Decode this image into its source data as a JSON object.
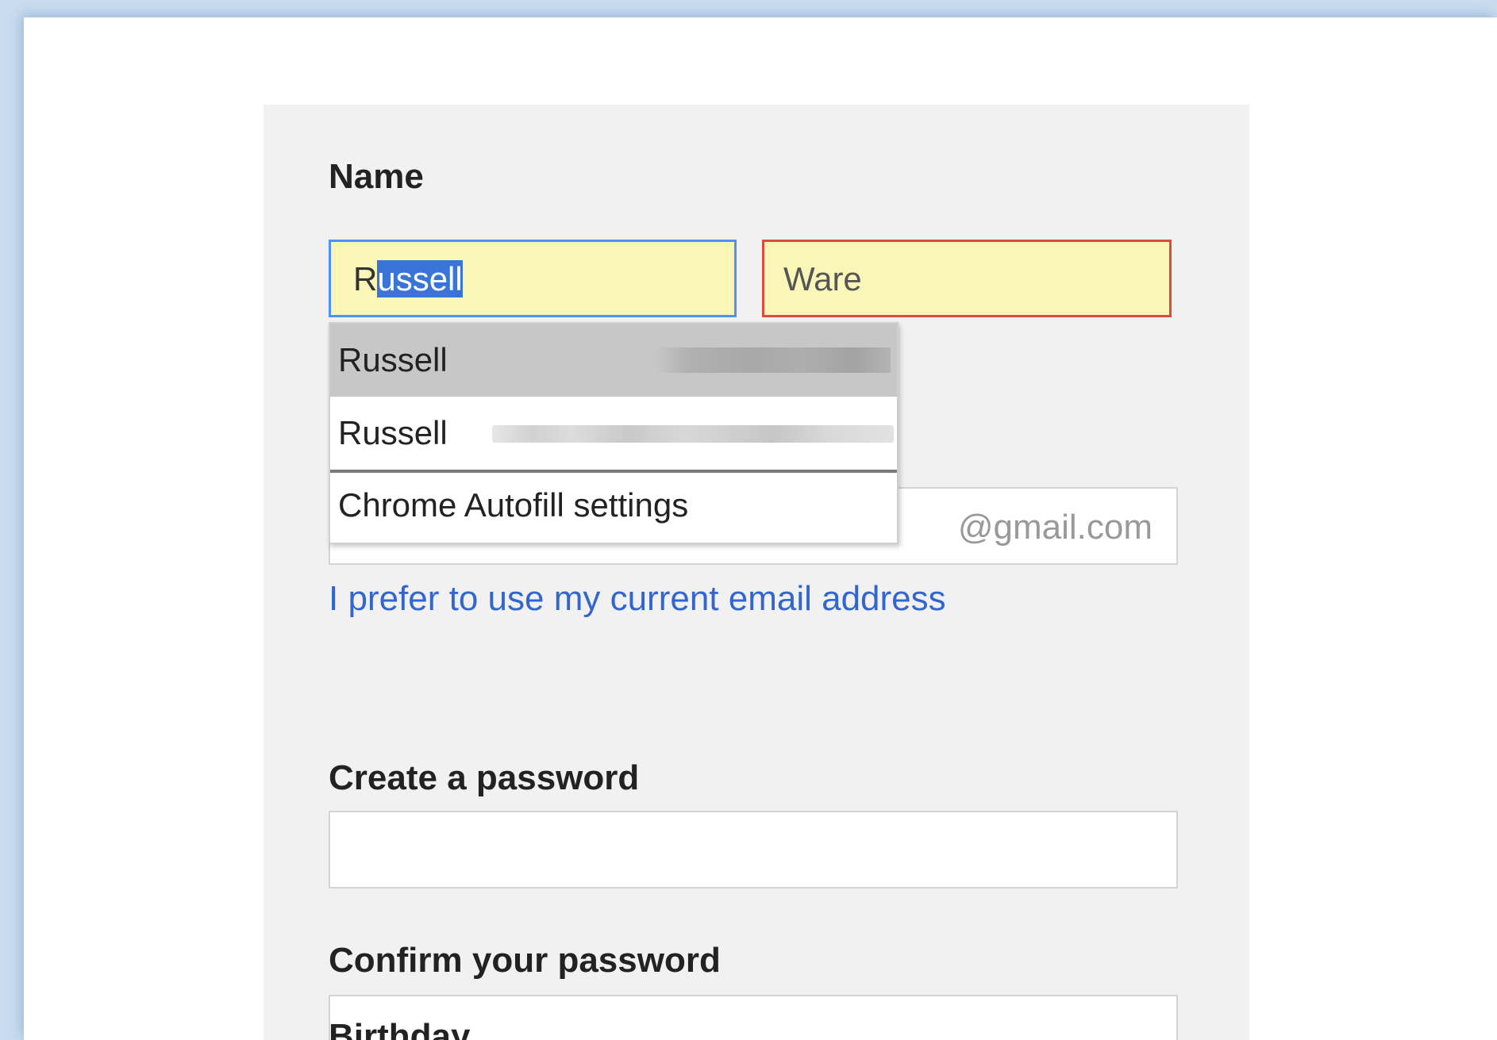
{
  "form": {
    "name_label": "Name",
    "first_name": {
      "value_unselected": "R",
      "value_selected": "ussell"
    },
    "last_name": {
      "value": "Ware"
    },
    "email": {
      "suffix": "@gmail.com"
    },
    "current_email_link": "I prefer to use my current email address",
    "password_label": "Create a password",
    "confirm_password_label": "Confirm your password",
    "birthday_label": "Birthday"
  },
  "autofill": {
    "suggestions": [
      {
        "name": "Russell"
      },
      {
        "name": "Russell"
      }
    ],
    "settings_label": "Chrome Autofill settings"
  },
  "colors": {
    "focus_border": "#4d90fe",
    "error_border": "#dd4b39",
    "autofill_background": "#faf6b8",
    "link": "#3366cc",
    "selection": "#3875d7"
  }
}
